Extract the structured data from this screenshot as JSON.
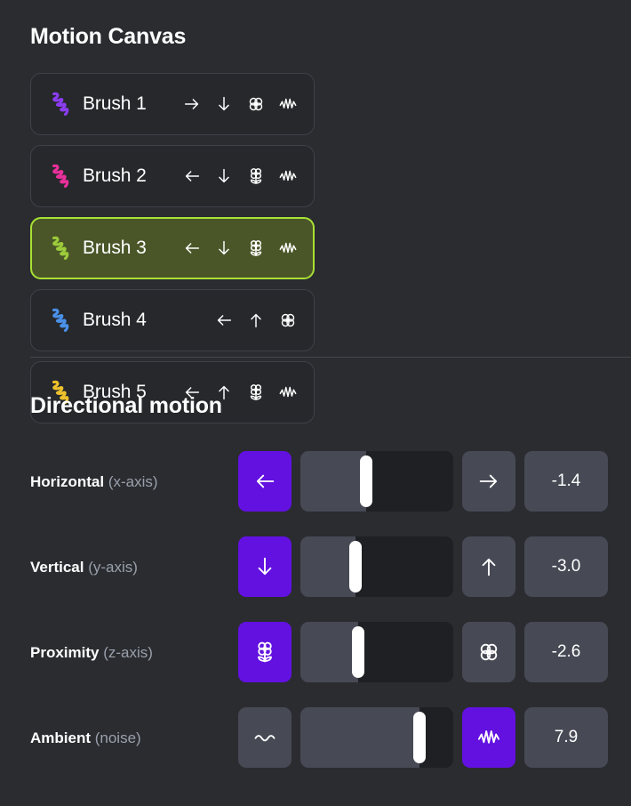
{
  "header": {
    "title": "Motion Canvas"
  },
  "brushes": {
    "items": [
      {
        "name": "Brush 1",
        "color": "#8b3df0",
        "selected": false,
        "icons": [
          "arrow-right-icon",
          "arrow-down-icon",
          "flower-blossom-icon",
          "wave-zigzag-icon"
        ]
      },
      {
        "name": "Brush 2",
        "color": "#e8309a",
        "selected": false,
        "icons": [
          "arrow-left-icon",
          "arrow-down-icon",
          "flower-stem-icon",
          "wave-zigzag-icon"
        ]
      },
      {
        "name": "Brush 3",
        "color": "#9ccb3b",
        "selected": true,
        "icons": [
          "arrow-left-icon",
          "arrow-down-icon",
          "flower-stem-icon",
          "wave-zigzag-icon"
        ]
      },
      {
        "name": "Brush 4",
        "color": "#4a90e8",
        "selected": false,
        "icons": [
          "arrow-left-icon",
          "arrow-up-icon",
          "flower-blossom-icon"
        ]
      },
      {
        "name": "Brush 5",
        "color": "#edc02c",
        "selected": false,
        "icons": [
          "arrow-left-icon",
          "arrow-up-icon",
          "flower-stem-icon",
          "wave-zigzag-icon"
        ]
      }
    ]
  },
  "motion": {
    "section_title": "Directional motion",
    "rows": [
      {
        "label": "Horizontal",
        "sublabel": "(x-axis)",
        "left_icon": "arrow-left-icon",
        "right_icon": "arrow-right-icon",
        "active_side": "left",
        "value": "-1.4",
        "thumb_percent": 43
      },
      {
        "label": "Vertical",
        "sublabel": "(y-axis)",
        "left_icon": "arrow-down-icon",
        "right_icon": "arrow-up-icon",
        "active_side": "left",
        "value": "-3.0",
        "thumb_percent": 36
      },
      {
        "label": "Proximity",
        "sublabel": "(z-axis)",
        "left_icon": "flower-stem-icon",
        "right_icon": "flower-blossom-icon",
        "active_side": "left",
        "value": "-2.6",
        "thumb_percent": 38
      },
      {
        "label": "Ambient",
        "sublabel": "(noise)",
        "left_icon": "wave-flat-icon",
        "right_icon": "wave-zigzag-icon",
        "active_side": "right",
        "value": "7.9",
        "thumb_percent": 78
      }
    ]
  },
  "colors": {
    "background": "#2a2c30",
    "accent_purple": "#6211e0",
    "selected_border": "#a9e034",
    "selected_fill": "#4a5628",
    "card_bg": "#26282c",
    "control_bg": "#474a54",
    "track_bg": "#1e2024",
    "muted_text": "#9aa0ab"
  }
}
